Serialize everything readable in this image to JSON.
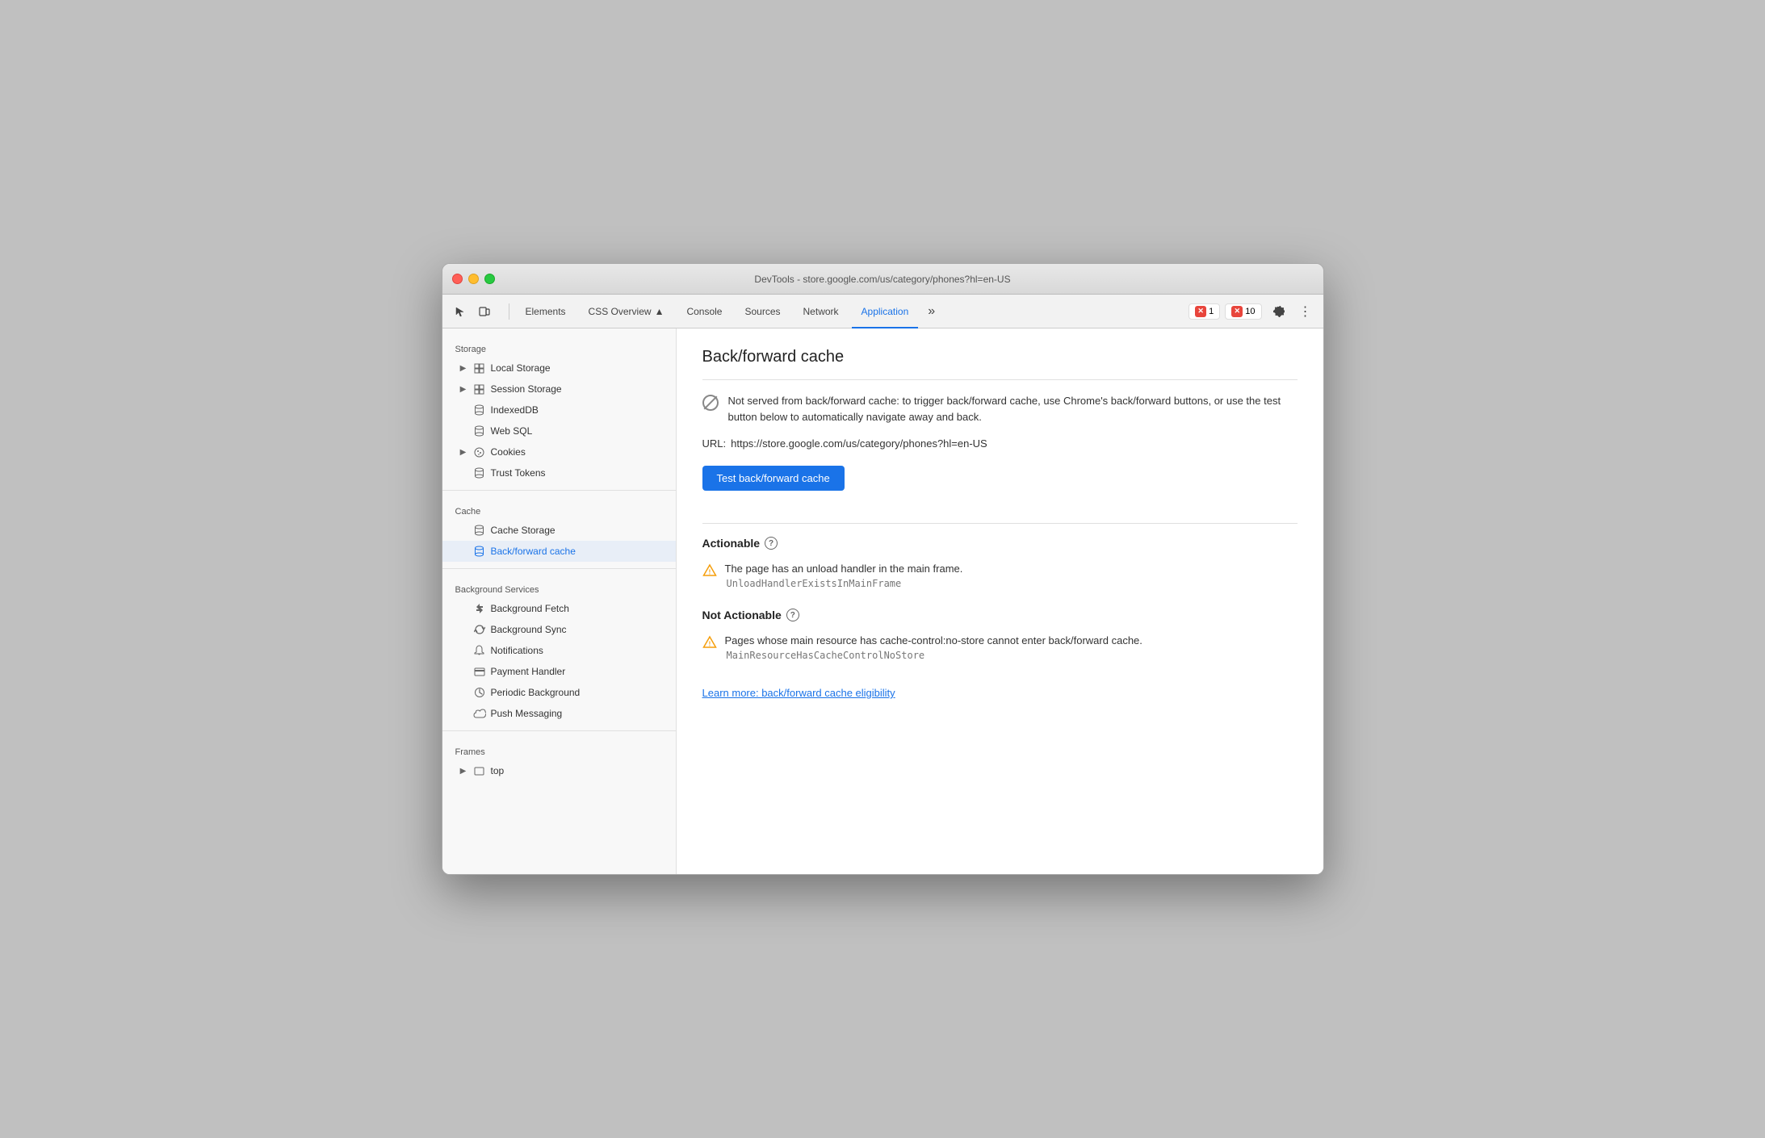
{
  "window": {
    "title": "DevTools - store.google.com/us/category/phones?hl=en-US"
  },
  "toolbar": {
    "tabs": [
      {
        "id": "elements",
        "label": "Elements",
        "active": false
      },
      {
        "id": "css-overview",
        "label": "CSS Overview",
        "active": false
      },
      {
        "id": "console",
        "label": "Console",
        "active": false
      },
      {
        "id": "sources",
        "label": "Sources",
        "active": false
      },
      {
        "id": "network",
        "label": "Network",
        "active": false
      },
      {
        "id": "application",
        "label": "Application",
        "active": true
      }
    ],
    "more_tabs": "»",
    "error_count": "1",
    "warning_count": "10"
  },
  "sidebar": {
    "storage_header": "Storage",
    "items": [
      {
        "id": "local-storage",
        "label": "Local Storage",
        "icon": "grid",
        "expandable": true,
        "indent": false
      },
      {
        "id": "session-storage",
        "label": "Session Storage",
        "icon": "grid",
        "expandable": true,
        "indent": false
      },
      {
        "id": "indexeddb",
        "label": "IndexedDB",
        "icon": "cylinder",
        "expandable": false,
        "indent": false
      },
      {
        "id": "web-sql",
        "label": "Web SQL",
        "icon": "cylinder",
        "expandable": false,
        "indent": false
      },
      {
        "id": "cookies",
        "label": "Cookies",
        "icon": "cookie",
        "expandable": true,
        "indent": false
      },
      {
        "id": "trust-tokens",
        "label": "Trust Tokens",
        "icon": "cylinder",
        "expandable": false,
        "indent": false
      }
    ],
    "cache_header": "Cache",
    "cache_items": [
      {
        "id": "cache-storage",
        "label": "Cache Storage",
        "icon": "cylinder",
        "active": false
      },
      {
        "id": "backforward-cache",
        "label": "Back/forward cache",
        "icon": "cylinder",
        "active": true
      }
    ],
    "bg_services_header": "Background Services",
    "bg_items": [
      {
        "id": "background-fetch",
        "label": "Background Fetch",
        "icon": "arrows"
      },
      {
        "id": "background-sync",
        "label": "Background Sync",
        "icon": "sync"
      },
      {
        "id": "notifications",
        "label": "Notifications",
        "icon": "bell"
      },
      {
        "id": "payment-handler",
        "label": "Payment Handler",
        "icon": "card"
      },
      {
        "id": "periodic-background",
        "label": "Periodic Background",
        "icon": "clock"
      },
      {
        "id": "push-messaging",
        "label": "Push Messaging",
        "icon": "cloud"
      }
    ],
    "frames_header": "Frames",
    "frames_items": [
      {
        "id": "top",
        "label": "top",
        "expandable": true
      }
    ]
  },
  "content": {
    "title": "Back/forward cache",
    "info_message": "Not served from back/forward cache: to trigger back/forward cache, use Chrome's back/forward buttons, or use the test button below to automatically navigate away and back.",
    "url_label": "URL:",
    "url_value": "https://store.google.com/us/category/phones?hl=en-US",
    "test_button": "Test back/forward cache",
    "actionable_title": "Actionable",
    "actionable_warning": "The page has an unload handler in the main frame.",
    "actionable_code": "UnloadHandlerExistsInMainFrame",
    "not_actionable_title": "Not Actionable",
    "not_actionable_warning": "Pages whose main resource has cache-control:no-store cannot enter back/forward cache.",
    "not_actionable_code": "MainResourceHasCacheControlNoStore",
    "learn_more_link": "Learn more: back/forward cache eligibility"
  }
}
